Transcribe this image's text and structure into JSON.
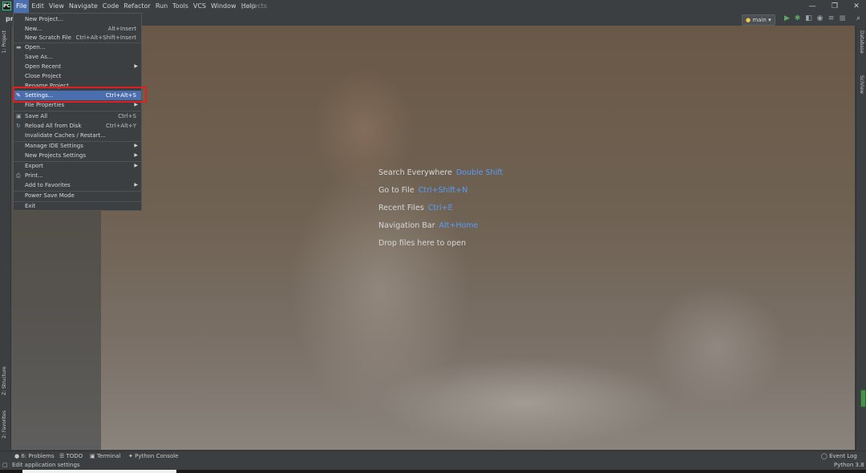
{
  "menubar": {
    "app_icon": "PC",
    "items": [
      "File",
      "Edit",
      "View",
      "Navigate",
      "Code",
      "Refactor",
      "Run",
      "Tools",
      "VCS",
      "Window",
      "Help"
    ],
    "active": "File",
    "window_title": "projects",
    "window_controls": [
      "—",
      "❐",
      "✕"
    ]
  },
  "navbar": {
    "breadcrumb": "pro",
    "branch": "main",
    "branch_icon": "python-icon"
  },
  "file_menu": {
    "items": [
      {
        "label": "New Project...",
        "shortcut": "",
        "submenu": false
      },
      {
        "label": "New...",
        "shortcut": "Alt+Insert",
        "submenu": false
      },
      {
        "label": "New Scratch File",
        "shortcut": "Ctrl+Alt+Shift+Insert",
        "submenu": false
      },
      {
        "label": "Open...",
        "shortcut": "",
        "submenu": false,
        "icon": "folder-icon"
      },
      {
        "label": "Save As...",
        "shortcut": "",
        "submenu": false
      },
      {
        "label": "Open Recent",
        "shortcut": "",
        "submenu": true
      },
      {
        "label": "Close Project",
        "shortcut": "",
        "submenu": false
      },
      {
        "label": "Rename Project...",
        "shortcut": "",
        "submenu": false
      },
      {
        "label": "Settings...",
        "shortcut": "Ctrl+Alt+S",
        "submenu": false,
        "icon": "wrench-icon",
        "selected": true
      },
      {
        "label": "File Properties",
        "shortcut": "",
        "submenu": true
      },
      {
        "label": "Save All",
        "shortcut": "Ctrl+S",
        "submenu": false,
        "icon": "save-icon"
      },
      {
        "label": "Reload All from Disk",
        "shortcut": "Ctrl+Alt+Y",
        "submenu": false,
        "icon": "reload-icon"
      },
      {
        "label": "Invalidate Caches / Restart...",
        "shortcut": "",
        "submenu": false
      },
      {
        "label": "Manage IDE Settings",
        "shortcut": "",
        "submenu": true
      },
      {
        "label": "New Projects Settings",
        "shortcut": "",
        "submenu": true
      },
      {
        "label": "Export",
        "shortcut": "",
        "submenu": true
      },
      {
        "label": "Print...",
        "shortcut": "",
        "submenu": false,
        "icon": "print-icon"
      },
      {
        "label": "Add to Favorites",
        "shortcut": "",
        "submenu": true
      },
      {
        "label": "Power Save Mode",
        "shortcut": "",
        "submenu": false
      },
      {
        "label": "Exit",
        "shortcut": "",
        "submenu": false
      }
    ]
  },
  "hints": [
    {
      "text": "Search Everywhere",
      "key": "Double Shift"
    },
    {
      "text": "Go to File",
      "key": "Ctrl+Shift+N"
    },
    {
      "text": "Recent Files",
      "key": "Ctrl+E"
    },
    {
      "text": "Navigation Bar",
      "key": "Alt+Home"
    },
    {
      "text": "Drop files here to open",
      "key": ""
    }
  ],
  "left_tabs": {
    "project": "1: Project",
    "structure": "Z: Structure",
    "favorites": "2: Favorites"
  },
  "right_tabs": {
    "database": "Database",
    "sciview": "SciView"
  },
  "bottom_tools": {
    "problems": "6: Problems",
    "todo": "TODO",
    "terminal": "Terminal",
    "python_console": "Python Console",
    "event_log": "Event Log"
  },
  "status": {
    "message": "Edit application settings",
    "interpreter": "Python 3.8"
  },
  "colors": {
    "accent": "#4b6eaf",
    "link": "#589df6",
    "highlight_border": "#e02020"
  }
}
